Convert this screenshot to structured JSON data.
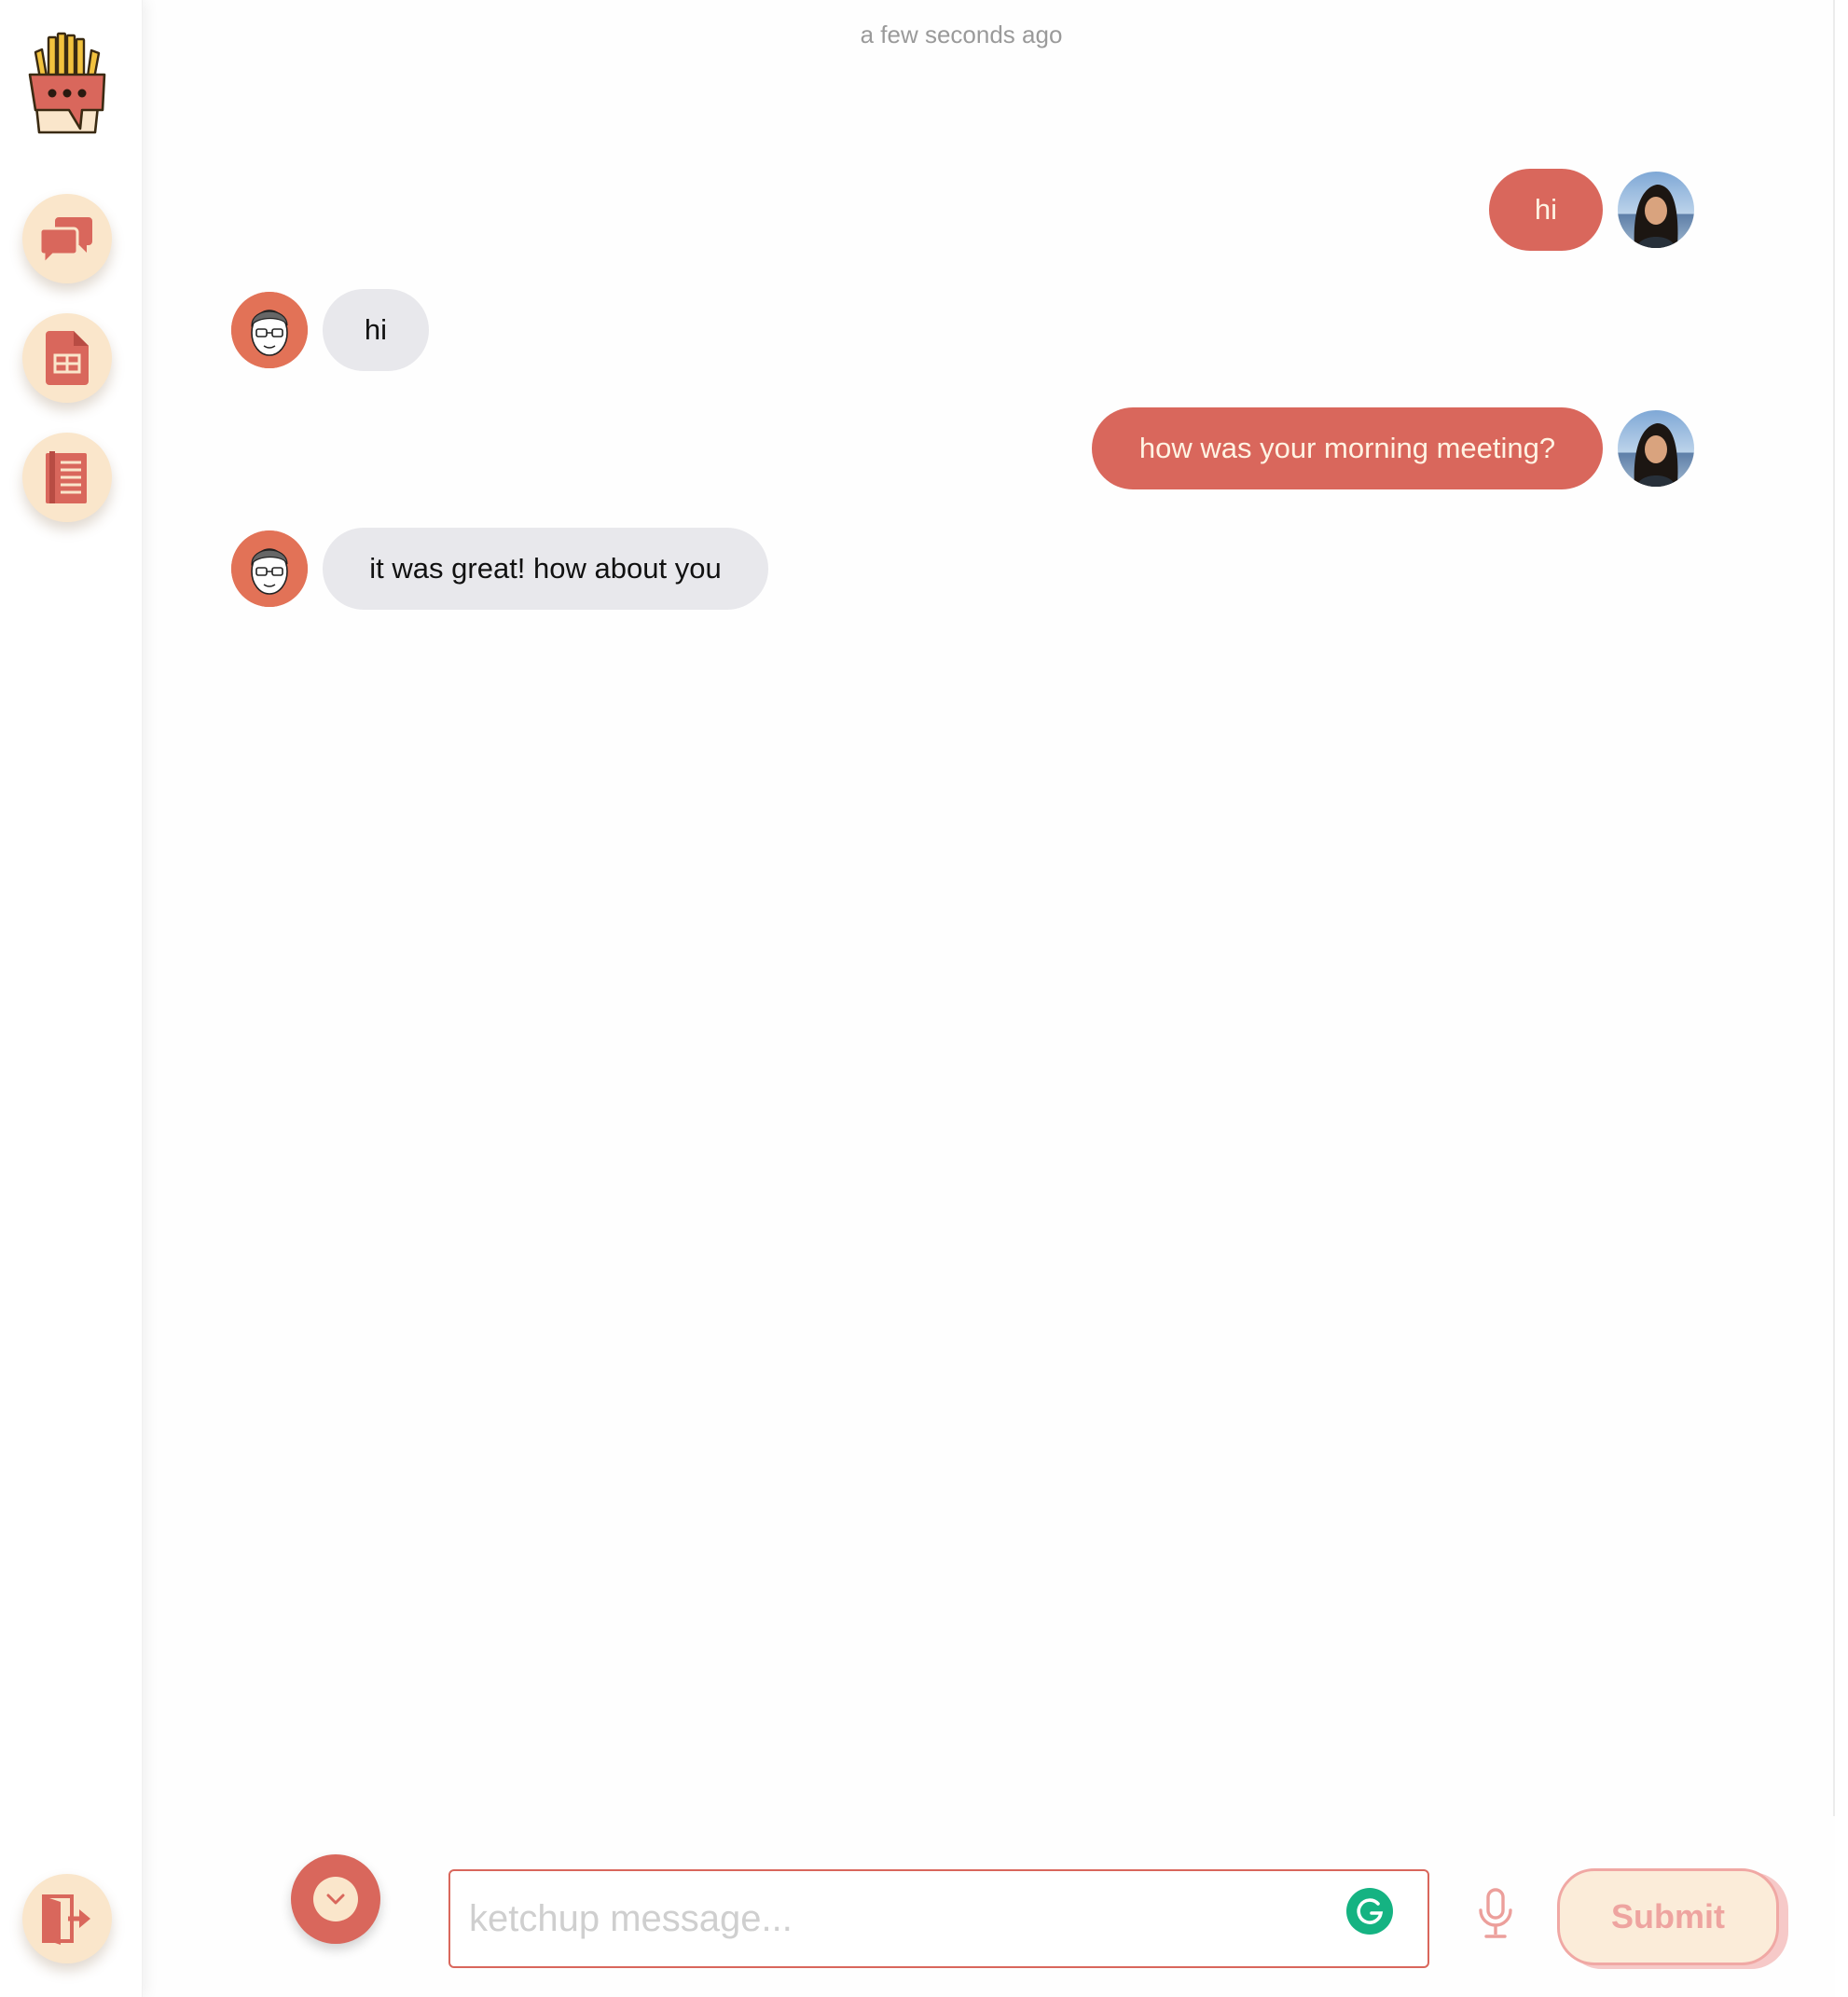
{
  "app": {
    "name": "ketchup",
    "accent_color": "#d9675c",
    "cream_color": "#fae6cb"
  },
  "sidebar": {
    "logo_icon": "fries-chat-logo-icon",
    "items": [
      {
        "name": "chats",
        "icon": "chat-bubbles-icon"
      },
      {
        "name": "documents",
        "icon": "document-table-icon"
      },
      {
        "name": "notebook",
        "icon": "notebook-icon"
      }
    ],
    "bottom_item": {
      "name": "logout",
      "icon": "logout-door-icon"
    }
  },
  "conversation": {
    "timestamp": "a few seconds ago",
    "messages": [
      {
        "direction": "outgoing",
        "text": "hi",
        "avatar": "user-avatar-woman"
      },
      {
        "direction": "incoming",
        "text": "hi",
        "avatar": "user-avatar-man"
      },
      {
        "direction": "outgoing",
        "text": "how was your morning meeting?",
        "avatar": "user-avatar-woman"
      },
      {
        "direction": "incoming",
        "text": "it was great! how about you",
        "avatar": "user-avatar-man"
      }
    ]
  },
  "composer": {
    "placeholder": "ketchup message...",
    "value": "",
    "submit_label": "Submit",
    "scroll_icon": "chevron-down-icon",
    "mic_icon": "microphone-icon",
    "grammarly_icon": "grammarly-icon"
  }
}
